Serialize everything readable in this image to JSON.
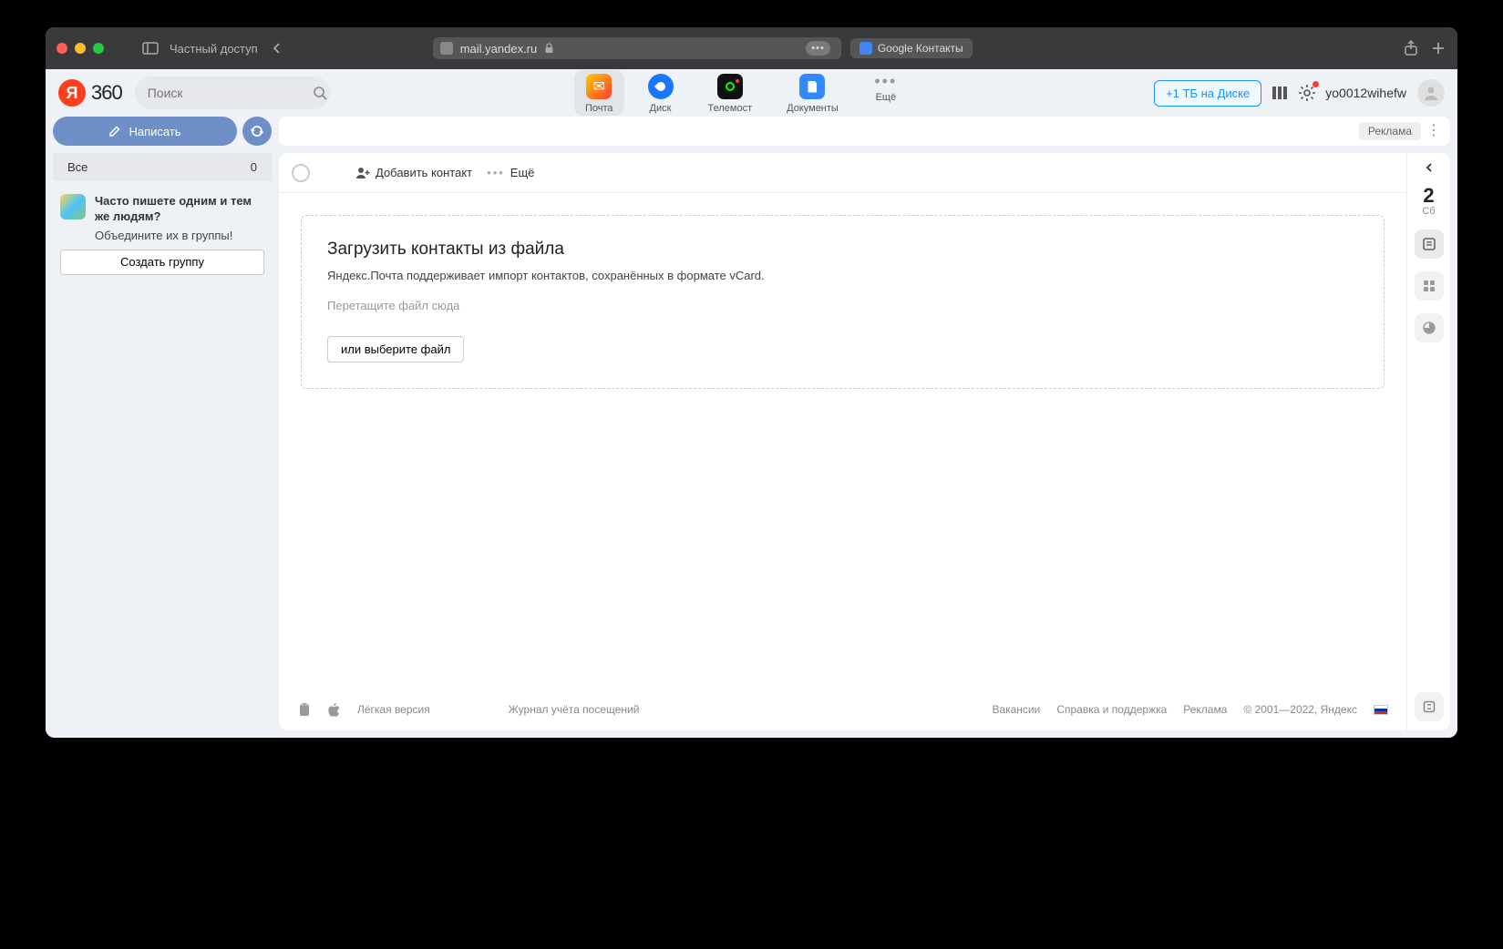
{
  "browser": {
    "private_label": "Частный доступ",
    "url": "mail.yandex.ru",
    "tab2": "Google Контакты"
  },
  "logo_text": "360",
  "search_placeholder": "Поиск",
  "nav": {
    "mail": "Почта",
    "disk": "Диск",
    "telemost": "Телемост",
    "docs": "Документы",
    "more": "Ещё"
  },
  "promo_disk": "+1 ТБ на Диске",
  "username": "yo0012wihefw",
  "compose": "Написать",
  "folder": {
    "name": "Все",
    "count": "0"
  },
  "promo_card": {
    "title": "Часто пишете одним и тем же людям?",
    "sub": "Объедините их в группы!",
    "button": "Создать группу"
  },
  "ad_label": "Реклама",
  "toolbar": {
    "add_contact": "Добавить контакт",
    "more": "Ещё"
  },
  "drop": {
    "title": "Загрузить контакты из файла",
    "sub": "Яндекс.Почта поддерживает импорт контактов, сохранённых в формате vCard.",
    "hint": "Перетащите файл сюда",
    "button": "или выберите файл"
  },
  "footer": {
    "light": "Лёгкая версия",
    "log": "Журнал учёта посещений",
    "vac": "Вакансии",
    "help": "Справка и поддержка",
    "ads": "Реклама",
    "copy": "© 2001—2022, Яндекс"
  },
  "calendar": {
    "day": "2",
    "dow": "Сб"
  }
}
